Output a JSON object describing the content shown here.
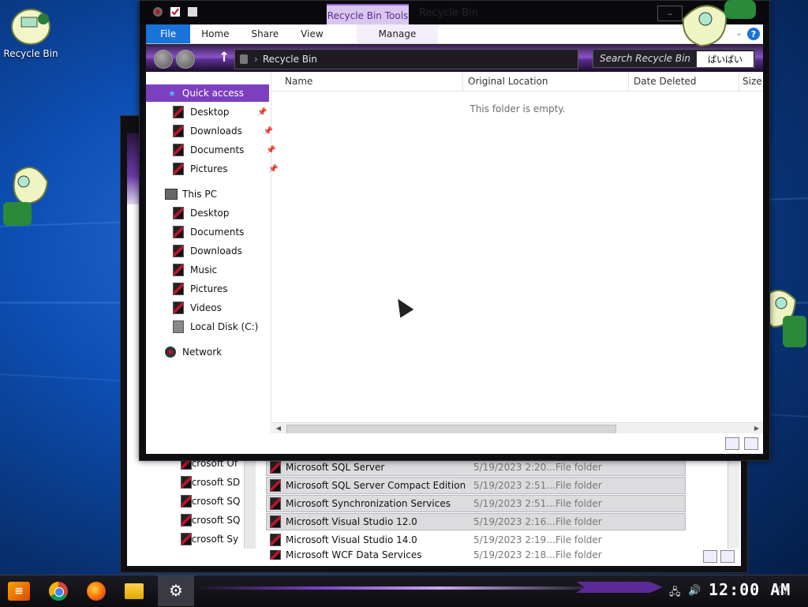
{
  "desktop": {
    "icons": [
      {
        "label": "Recycle Bin",
        "icon": "recycle-bin-icon"
      }
    ]
  },
  "explorer": {
    "quick_access_toolbar": [
      "properties-icon",
      "new-folder-icon",
      "customize-dropdown-icon"
    ],
    "context_tab": "Recycle Bin Tools",
    "title": "Recycle Bin",
    "ribbon_tabs": {
      "file": "File",
      "home": "Home",
      "share": "Share",
      "view": "View",
      "manage": "Manage"
    },
    "address": {
      "path": "Recycle Bin",
      "search_placeholder": "Search Recycle Bin",
      "extra_badge": "ぱいぱい"
    },
    "nav": {
      "quick_access": "Quick access",
      "qa_items": [
        {
          "label": "Desktop",
          "pinned": true
        },
        {
          "label": "Downloads",
          "pinned": true
        },
        {
          "label": "Documents",
          "pinned": true
        },
        {
          "label": "Pictures",
          "pinned": true
        }
      ],
      "this_pc": "This PC",
      "pc_items": [
        "Desktop",
        "Documents",
        "Downloads",
        "Music",
        "Pictures",
        "Videos",
        "Local Disk (C:)"
      ],
      "network": "Network"
    },
    "columns": [
      "Name",
      "Original Location",
      "Date Deleted",
      "Size"
    ],
    "empty_message": "This folder is empty."
  },
  "background_window": {
    "sidebar_items": [
      "Microsoft Of",
      "Microsoft SD",
      "Microsoft SQ",
      "Microsoft SQ",
      "Microsoft Sy"
    ],
    "rows": [
      {
        "name": "Microsoft SQL Server",
        "date": "5/19/2023 2:20...",
        "type": "File folder",
        "selected": true
      },
      {
        "name": "Microsoft SQL Server Compact Edition",
        "date": "5/19/2023 2:51...",
        "type": "File folder",
        "selected": true
      },
      {
        "name": "Microsoft Synchronization Services",
        "date": "5/19/2023 2:51...",
        "type": "File folder",
        "selected": true
      },
      {
        "name": "Microsoft Visual Studio 12.0",
        "date": "5/19/2023 2:16...",
        "type": "File folder",
        "selected": true
      },
      {
        "name": "Microsoft Visual Studio 14.0",
        "date": "5/19/2023 2:19...",
        "type": "File folder",
        "selected": false
      },
      {
        "name": "Microsoft WCF Data Services",
        "date": "5/19/2023 2:18...",
        "type": "File folder",
        "selected": false
      }
    ]
  },
  "taskbar": {
    "apps": [
      "start-icon",
      "chrome-icon",
      "firefox-icon",
      "file-explorer-icon",
      "settings-icon"
    ],
    "clock": "12:00 AM"
  },
  "colors": {
    "accent_purple": "#7b3fc0",
    "file_tab_blue": "#1a73d9",
    "icon_red": "#c0122a"
  }
}
